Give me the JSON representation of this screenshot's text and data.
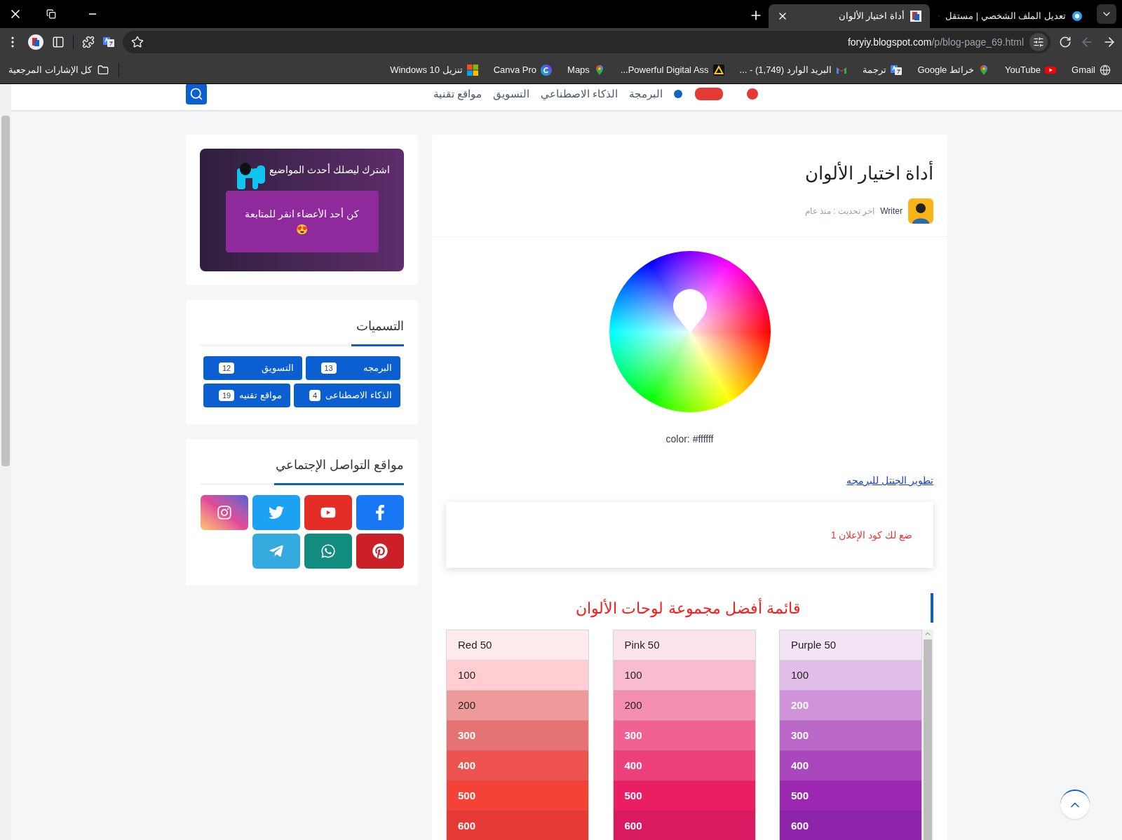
{
  "browser": {
    "tabs": [
      {
        "title": "تعديل الملف الشخصي | مستقل",
        "selected": false,
        "kind": "ring"
      },
      {
        "title": "أداة اختيار الألوان",
        "selected": true,
        "kind": "page"
      }
    ],
    "url_host": "foryiy.blogspot.com",
    "url_path": "/p/blog-page_69.html",
    "bookmarks": [
      {
        "label": "Gmail",
        "kind": "globe"
      },
      {
        "label": "YouTube",
        "kind": "youtube"
      },
      {
        "label": "خرائط Google",
        "kind": "maps"
      },
      {
        "label": "ترجمة",
        "kind": "translate"
      },
      {
        "label": "البريد الوارد (1,749) - ...",
        "kind": "gmail"
      },
      {
        "label": "Powerful Digital Ass...",
        "kind": "triangle"
      },
      {
        "label": "Maps",
        "kind": "maps"
      },
      {
        "label": "Canva Pro",
        "kind": "canva"
      },
      {
        "label": "تنزيل Windows 10",
        "kind": "windows"
      }
    ],
    "all_bookmarks": "كل الإشارات المرجعية"
  },
  "site_nav": [
    "البرمجة",
    "الذكاء الاصطناعي",
    "التسويق",
    "مواقع تقنية"
  ],
  "post": {
    "title": "أداة اختيار الألوان",
    "author": "Writer",
    "updated": "اخر تحديث : منذ عام",
    "color_reading": "color: #ffffff",
    "link": "تطوير الجنتل للبرمجه",
    "ad_text": "ضع لك كود الإعلان 1",
    "palettes_heading": "قائمة أفضل مجموعة لوحات الألوان",
    "palettes": [
      {
        "swatches": [
          {
            "label": "Purple 50",
            "color": "#f3e5f5"
          },
          {
            "label": "100",
            "color": "#e1bee7"
          },
          {
            "label": "200",
            "color": "#ce93d8"
          },
          {
            "label": "300",
            "color": "#ba68c8"
          },
          {
            "label": "400",
            "color": "#ab47bc"
          },
          {
            "label": "500",
            "color": "#9c27b0"
          },
          {
            "label": "600",
            "color": "#8e24aa"
          }
        ]
      },
      {
        "swatches": [
          {
            "label": "Pink 50",
            "color": "#fce4ec"
          },
          {
            "label": "100",
            "color": "#f8bbd0"
          },
          {
            "label": "200",
            "color": "#f48fb1"
          },
          {
            "label": "300",
            "color": "#f06292"
          },
          {
            "label": "400",
            "color": "#ec407a"
          },
          {
            "label": "500",
            "color": "#e91e63"
          },
          {
            "label": "600",
            "color": "#d81b60"
          }
        ]
      },
      {
        "swatches": [
          {
            "label": "Red 50",
            "color": "#ffebee"
          },
          {
            "label": "100",
            "color": "#ffcdd2"
          },
          {
            "label": "200",
            "color": "#ef9a9a"
          },
          {
            "label": "300",
            "color": "#e57373"
          },
          {
            "label": "400",
            "color": "#ef5350"
          },
          {
            "label": "500",
            "color": "#f44336"
          },
          {
            "label": "600",
            "color": "#e53935"
          }
        ]
      }
    ]
  },
  "sidebar": {
    "subscribe": {
      "title": "اشترك ليصلك أحدث المواضيع",
      "button": "كن أحد الأعضاء انقر للمتابعة",
      "emoji": "😍"
    },
    "labels": {
      "title": "التسميات",
      "items": [
        {
          "name": "البرمجه",
          "count": "13"
        },
        {
          "name": "التسويق",
          "count": "12"
        },
        {
          "name": "الذكاء الاصطناعى",
          "count": "4"
        },
        {
          "name": "مواقع تقنيه",
          "count": "19"
        }
      ]
    },
    "social": {
      "title": "مواقع التواصل الإجتماعي",
      "items": [
        {
          "kind": "facebook"
        },
        {
          "kind": "youtube"
        },
        {
          "kind": "twitter"
        },
        {
          "kind": "instagram"
        },
        {
          "kind": "pinterest"
        },
        {
          "kind": "whatsapp"
        },
        {
          "kind": "telegram"
        }
      ]
    }
  }
}
